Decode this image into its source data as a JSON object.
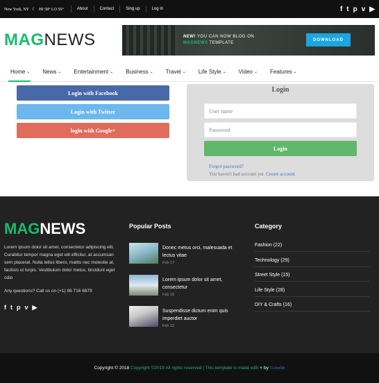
{
  "topbar": {
    "location": "New York, NY",
    "weather": "HI 58° LO 56°",
    "links": [
      "About",
      "Contact",
      "Sing up",
      "Log In"
    ],
    "social": [
      "f",
      "t",
      "p",
      "v",
      "yt"
    ]
  },
  "header": {
    "logo_green": "MAG",
    "logo_dark": "NEWS",
    "banner_line1_bold": "NEW!",
    "banner_line1": " YOU CAN NOW BLOG ON",
    "banner_line2_green": "MAGNEWS",
    "banner_line2": " TEMPLATE",
    "banner_button": "DOWNLOAD"
  },
  "nav": [
    {
      "label": "Home"
    },
    {
      "label": "News"
    },
    {
      "label": "Entertainment"
    },
    {
      "label": "Business"
    },
    {
      "label": "Travel"
    },
    {
      "label": "Life Style"
    },
    {
      "label": "Video"
    },
    {
      "label": "Features"
    }
  ],
  "social_login": {
    "facebook": "Login with Facebook",
    "twitter": "Login with Twitter",
    "google": "login with Google+"
  },
  "login": {
    "title": "Login",
    "username_placeholder": "User name",
    "password_placeholder": "Password",
    "button": "Login",
    "forgot": "Forgot password?",
    "no_account": "You haven't had account yet.",
    "create": "Create account"
  },
  "footer": {
    "about": "Lorem ipsum dolor sit amet, consectetur adipiscing elit. Curabitur tempor magna eget elit efficitur, at accumsan sem placerat. Nulla tellus libero, mattis nec molestie at, facilisis ut turpis. Vestibulum dolor metus, tincidunt eget odio",
    "questions": "Any questions? Call us on (+1) 96 716 6879",
    "popular_title": "Popular Posts",
    "posts": [
      {
        "title": "Donec metus orci, malesuada et lectus vitae",
        "date": "Feb 17"
      },
      {
        "title": "Lorem ipsum dolor sit amet, consectetur",
        "date": "Feb 16"
      },
      {
        "title": "Suspendisse dictum enim quis imperdiet auctor",
        "date": "Feb 15"
      }
    ],
    "category_title": "Category",
    "categories": [
      "Fashion (22)",
      "Technology (29)",
      "Street Style (15)",
      "Life Style (28)",
      "DIY & Crafts (16)"
    ]
  },
  "copyright": {
    "lead": "Copyright © 2018",
    "middle": "Copyright ©2019 All rights reserved | This template is made with",
    "brand": "Colorlib"
  }
}
